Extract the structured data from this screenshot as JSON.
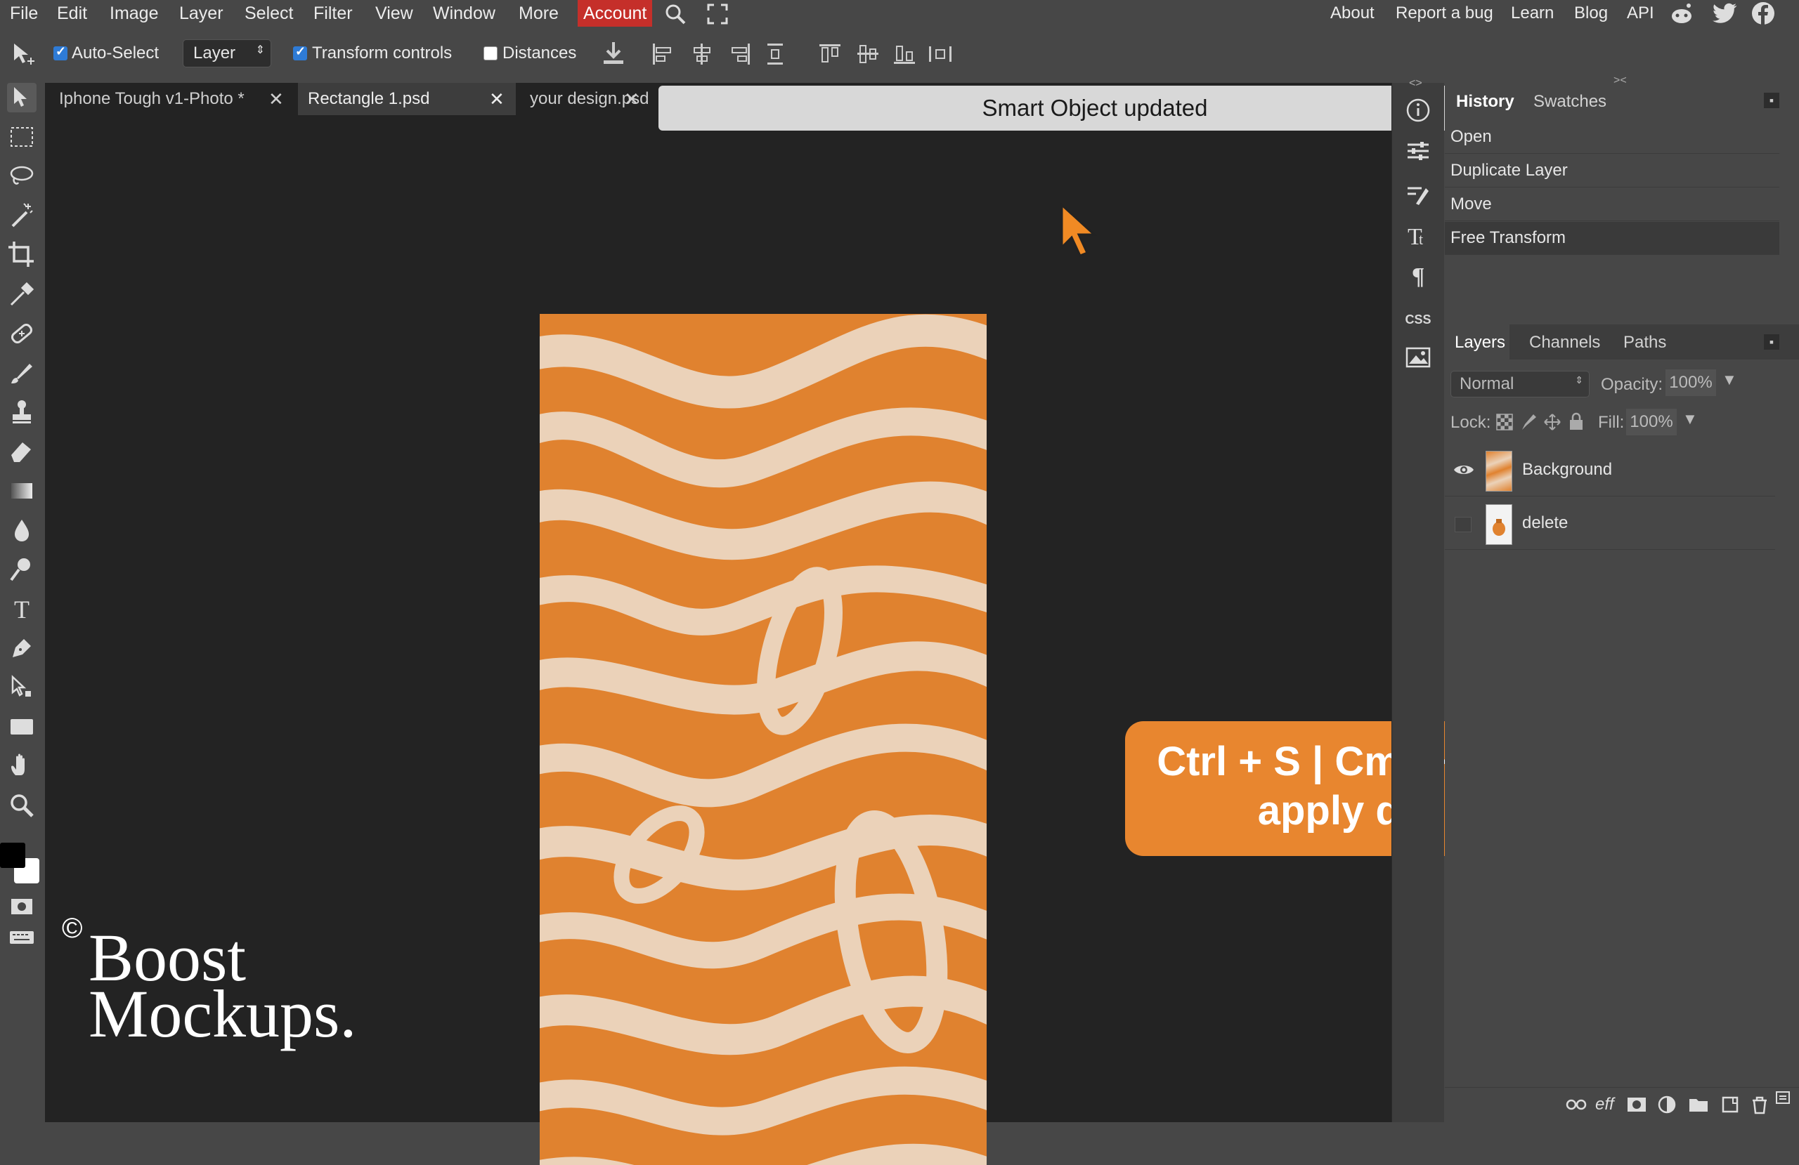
{
  "menu": {
    "items": [
      "File",
      "Edit",
      "Image",
      "Layer",
      "Select",
      "Filter",
      "View",
      "Window",
      "More"
    ],
    "account": "Account",
    "right_links": [
      "About",
      "Report a bug",
      "Learn",
      "Blog",
      "API"
    ]
  },
  "options": {
    "auto_select_label": "Auto-Select",
    "auto_select_checked": true,
    "layer_select": "Layer",
    "transform_controls_label": "Transform controls",
    "transform_controls_checked": true,
    "distances_label": "Distances",
    "distances_checked": false
  },
  "tabs": [
    {
      "label": "Iphone Tough v1-Photo *"
    },
    {
      "label": "Rectangle 1.psd"
    },
    {
      "label": "your design.psd"
    }
  ],
  "toast": "Smart Object updated",
  "callout": {
    "line1": "Ctrl + S | Cmd + S(mac)",
    "line2": "apply design"
  },
  "watermark": {
    "copyright": "©",
    "line1": "Boost",
    "line2": "Mockups."
  },
  "side_icons": {
    "css_label": "CSS"
  },
  "history_panel": {
    "tabs": [
      "History",
      "Swatches"
    ],
    "items": [
      "Open",
      "Duplicate Layer",
      "Move",
      "Free Transform"
    ],
    "selected_index": 3
  },
  "layers_panel": {
    "tabs": [
      "Layers",
      "Channels",
      "Paths"
    ],
    "blend_mode": "Normal",
    "opacity_label": "Opacity:",
    "opacity_value": "100%",
    "lock_label": "Lock:",
    "fill_label": "Fill:",
    "fill_value": "100%",
    "layers": [
      {
        "name": "Background",
        "visible": true
      },
      {
        "name": "delete",
        "visible": false
      }
    ],
    "bottom_eff": "eff"
  },
  "colors": {
    "accent_account": "#c52f2a",
    "pattern_orange": "#e0822f",
    "pattern_cream": "#ebd2b9",
    "callout": "#e8862f"
  }
}
